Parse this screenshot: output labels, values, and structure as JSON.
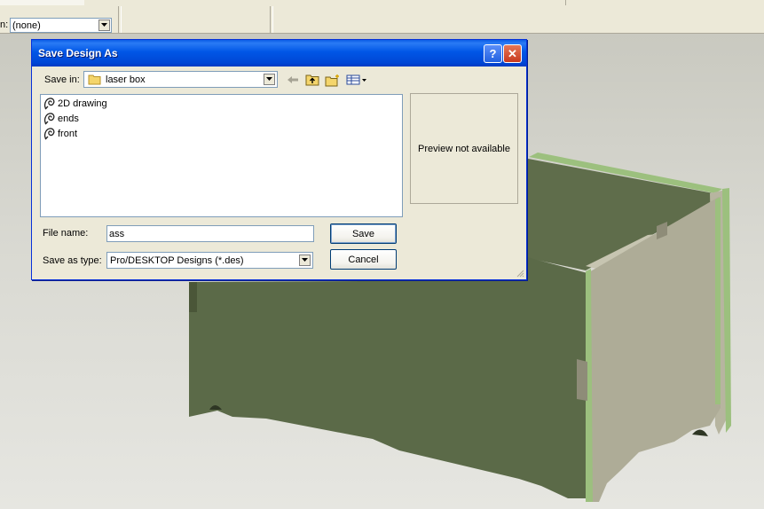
{
  "workspace": {
    "label": "n:",
    "combo_value": "(none)"
  },
  "dialog": {
    "title": "Save Design As",
    "help_glyph": "?",
    "close_glyph": "✕",
    "save_in_label": "Save in:",
    "save_in_value": "laser box",
    "files": [
      {
        "name": "2D drawing",
        "icon": "design-file-icon"
      },
      {
        "name": "ends",
        "icon": "design-file-icon"
      },
      {
        "name": "front",
        "icon": "design-file-icon"
      }
    ],
    "preview_text": "Preview not available",
    "file_name_label": "File name:",
    "file_name_value": "ass",
    "save_as_type_label": "Save as type:",
    "save_as_type_value": "Pro/DESKTOP Designs (*.des)",
    "save_button": "Save",
    "cancel_button": "Cancel",
    "toolbar_icons": [
      "back-arrow-icon",
      "up-folder-icon",
      "new-folder-icon",
      "view-menu-icon"
    ]
  },
  "colors": {
    "title_bar": "#0054e3",
    "model_face": "#5b6a48",
    "model_side": "#b0ae99",
    "model_edge": "#9cc07e"
  }
}
